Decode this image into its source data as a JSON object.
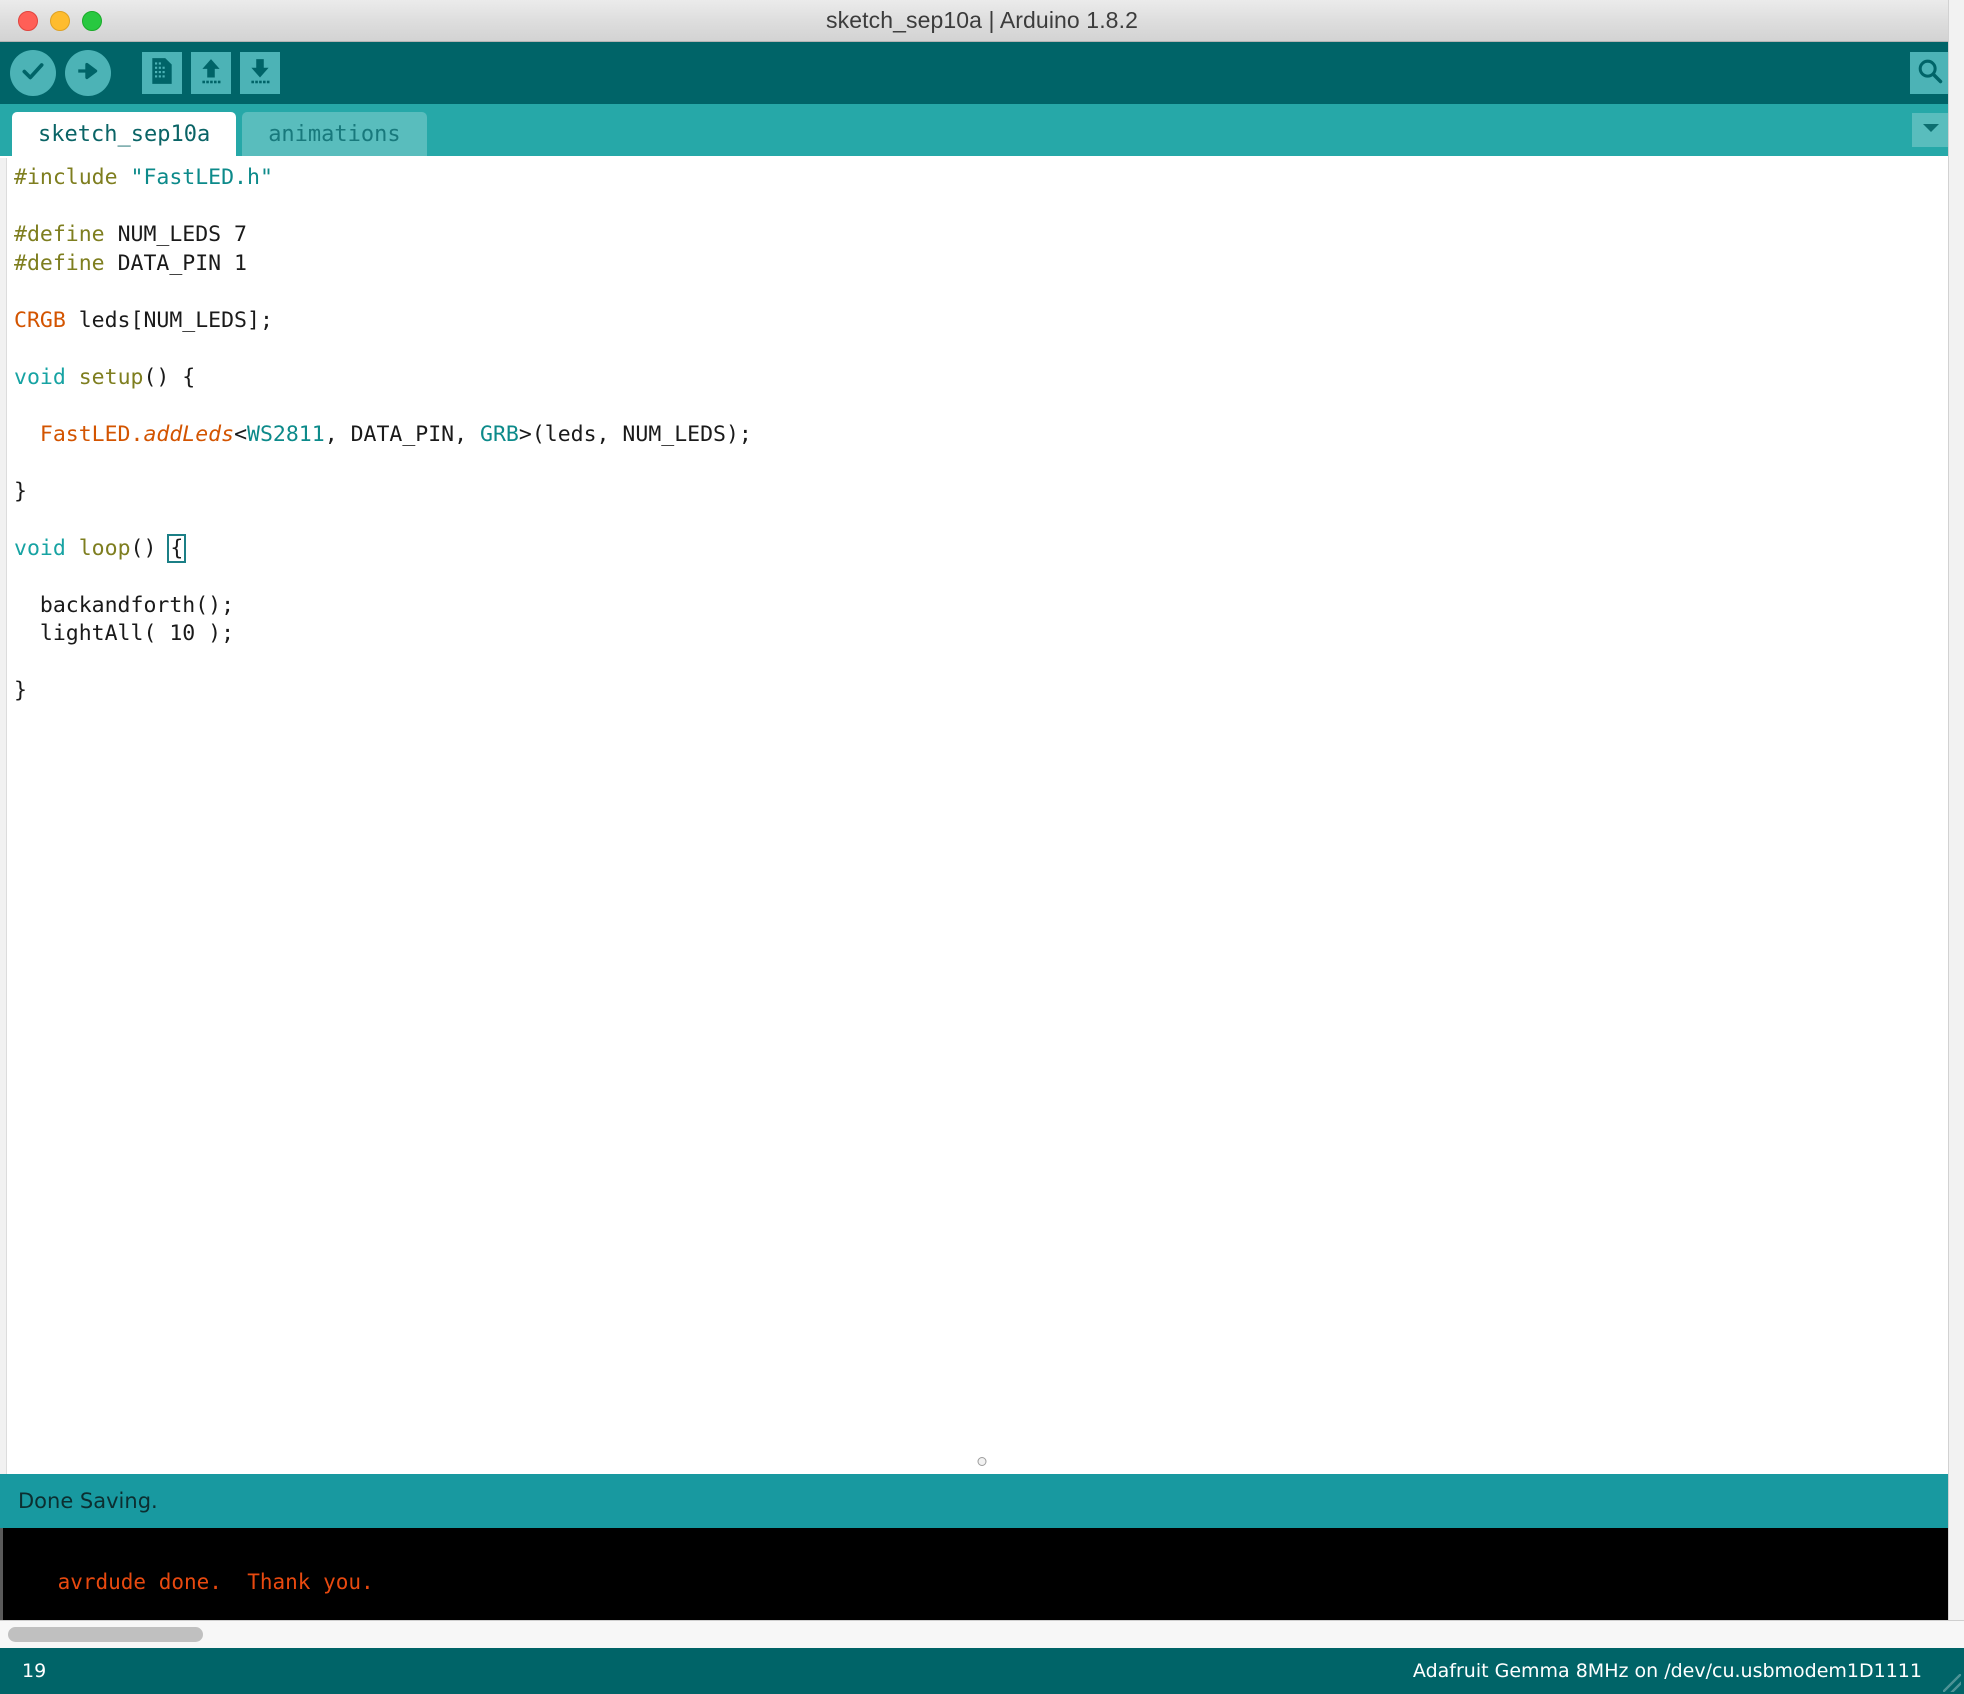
{
  "window": {
    "title": "sketch_sep10a | Arduino 1.8.2",
    "traffic_lights": [
      "close",
      "minimize",
      "maximize"
    ]
  },
  "toolbar": {
    "buttons": [
      {
        "name": "verify-button",
        "icon": "checkmark-icon",
        "tooltip": "Verify"
      },
      {
        "name": "upload-button",
        "icon": "arrow-right-icon",
        "tooltip": "Upload"
      },
      {
        "name": "new-button",
        "icon": "new-document-icon",
        "tooltip": "New"
      },
      {
        "name": "open-button",
        "icon": "arrow-up-icon",
        "tooltip": "Open"
      },
      {
        "name": "save-button",
        "icon": "arrow-down-icon",
        "tooltip": "Save"
      },
      {
        "name": "serial-monitor-button",
        "icon": "magnifier-icon",
        "tooltip": "Serial Monitor"
      }
    ]
  },
  "tabs": {
    "items": [
      {
        "label": "sketch_sep10a",
        "active": true
      },
      {
        "label": "animations",
        "active": false
      }
    ],
    "menu_icon": "chevron-down-icon"
  },
  "editor": {
    "lines": [
      [
        {
          "t": "#include ",
          "c": "k-pre"
        },
        {
          "t": "\"FastLED.h\"",
          "c": "k-str"
        }
      ],
      [
        {
          "t": "",
          "c": "k-plain"
        }
      ],
      [
        {
          "t": "#define ",
          "c": "k-pre"
        },
        {
          "t": "NUM_LEDS 7",
          "c": "k-plain"
        }
      ],
      [
        {
          "t": "#define ",
          "c": "k-pre"
        },
        {
          "t": "DATA_PIN 1",
          "c": "k-plain"
        }
      ],
      [
        {
          "t": "",
          "c": "k-plain"
        }
      ],
      [
        {
          "t": "CRGB",
          "c": "k-type"
        },
        {
          "t": " leds[NUM_LEDS];",
          "c": "k-plain"
        }
      ],
      [
        {
          "t": "",
          "c": "k-plain"
        }
      ],
      [
        {
          "t": "void",
          "c": "k-void"
        },
        {
          "t": " ",
          "c": "k-plain"
        },
        {
          "t": "setup",
          "c": "k-fn"
        },
        {
          "t": "() {",
          "c": "k-plain"
        }
      ],
      [
        {
          "t": "",
          "c": "k-plain"
        }
      ],
      [
        {
          "t": "  ",
          "c": "k-plain"
        },
        {
          "t": "FastLED.",
          "c": "k-type"
        },
        {
          "t": "addLeds",
          "c": "k-ital"
        },
        {
          "t": "<",
          "c": "k-plain"
        },
        {
          "t": "WS2811",
          "c": "k-tmpl"
        },
        {
          "t": ", DATA_PIN, ",
          "c": "k-plain"
        },
        {
          "t": "GRB",
          "c": "k-tmpl"
        },
        {
          "t": ">(leds, NUM_LEDS);",
          "c": "k-plain"
        }
      ],
      [
        {
          "t": "",
          "c": "k-plain"
        }
      ],
      [
        {
          "t": "}",
          "c": "k-plain"
        }
      ],
      [
        {
          "t": "",
          "c": "k-plain"
        }
      ],
      [
        {
          "t": "void",
          "c": "k-void"
        },
        {
          "t": " ",
          "c": "k-plain"
        },
        {
          "t": "loop",
          "c": "k-fn"
        },
        {
          "t": "() ",
          "c": "k-plain"
        },
        {
          "t": "{",
          "c": "k-plain brace-hl"
        }
      ],
      [
        {
          "t": "",
          "c": "k-plain"
        }
      ],
      [
        {
          "t": "  backandforth();",
          "c": "k-plain"
        }
      ],
      [
        {
          "t": "  lightAll( 10 );",
          "c": "k-plain"
        }
      ],
      [
        {
          "t": "",
          "c": "k-plain"
        }
      ],
      [
        {
          "t": "}",
          "c": "k-plain"
        }
      ]
    ]
  },
  "status_strip": {
    "message": "Done Saving."
  },
  "console": {
    "text": "avrdude done.  Thank you."
  },
  "footer": {
    "line_number": "19",
    "board_info": "Adafruit Gemma 8MHz on /dev/cu.usbmodem1D1111"
  },
  "colors": {
    "toolbar_bg": "#006468",
    "tabbar_bg": "#26a8a8",
    "status_bg": "#1899a0",
    "console_fg": "#e8490f",
    "icon_bg": "#4cb3b6"
  }
}
